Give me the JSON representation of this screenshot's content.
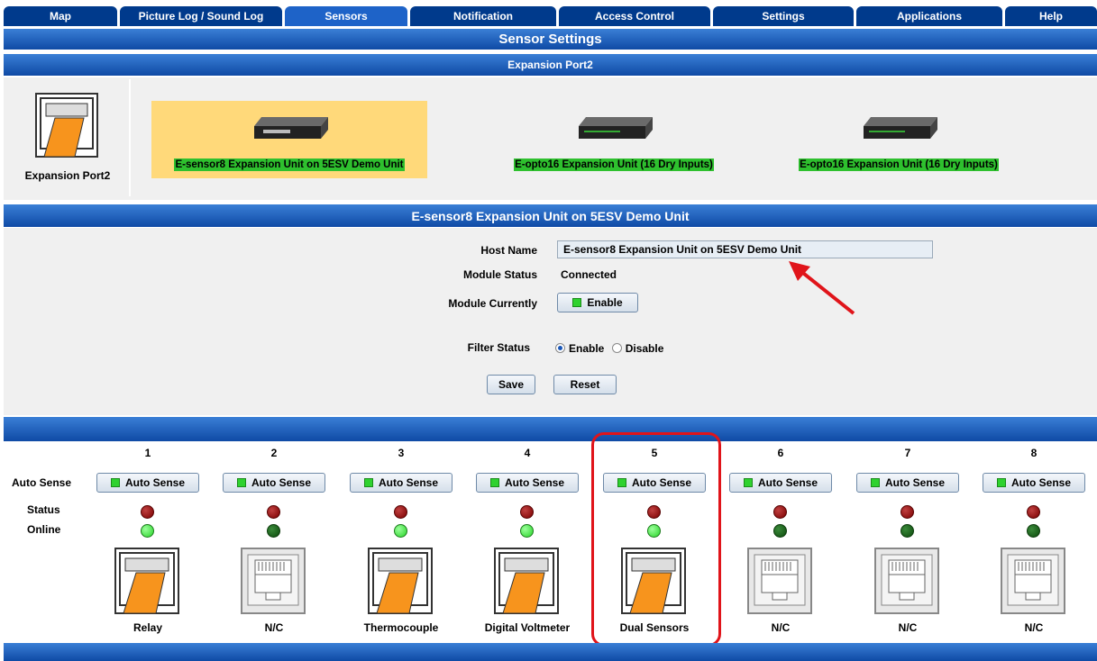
{
  "tabs": [
    {
      "label": "Map"
    },
    {
      "label": "Picture Log / Sound Log"
    },
    {
      "label": "Sensors"
    },
    {
      "label": "Notification"
    },
    {
      "label": "Access Control"
    },
    {
      "label": "Settings"
    },
    {
      "label": "Applications"
    },
    {
      "label": "Help"
    }
  ],
  "active_tab": "Sensors",
  "section_title": "Sensor Settings",
  "expansion_title": "Expansion Port2",
  "port_label": "Expansion Port2",
  "units": [
    {
      "label": "E-sensor8 Expansion Unit on 5ESV Demo Unit",
      "selected": true
    },
    {
      "label": "E-opto16 Expansion Unit (16 Dry Inputs)",
      "selected": false
    },
    {
      "label": "E-opto16 Expansion Unit (16 Dry Inputs)",
      "selected": false
    }
  ],
  "unit_title": "E-sensor8 Expansion Unit on 5ESV Demo Unit",
  "form": {
    "host_name_label": "Host Name",
    "host_name_value": "E-sensor8 Expansion Unit on 5ESV Demo Unit",
    "module_status_label": "Module Status",
    "module_status_value": "Connected",
    "module_currently_label": "Module Currently",
    "module_currently_button": "Enable",
    "filter_status_label": "Filter Status",
    "filter_enable": "Enable",
    "filter_disable": "Disable",
    "filter_selected": "Enable",
    "save": "Save",
    "reset": "Reset"
  },
  "row_labels": {
    "auto_sense": "Auto Sense",
    "status": "Status",
    "online": "Online"
  },
  "channels": [
    {
      "num": "1",
      "button": "Auto Sense",
      "online": true,
      "connected": true,
      "name": "Relay"
    },
    {
      "num": "2",
      "button": "Auto Sense",
      "online": false,
      "connected": false,
      "name": "N/C"
    },
    {
      "num": "3",
      "button": "Auto Sense",
      "online": true,
      "connected": true,
      "name": "Thermocouple"
    },
    {
      "num": "4",
      "button": "Auto Sense",
      "online": true,
      "connected": true,
      "name": "Digital Voltmeter"
    },
    {
      "num": "5",
      "button": "Auto Sense",
      "online": true,
      "connected": true,
      "name": "Dual Sensors"
    },
    {
      "num": "6",
      "button": "Auto Sense",
      "online": false,
      "connected": false,
      "name": "N/C"
    },
    {
      "num": "7",
      "button": "Auto Sense",
      "online": false,
      "connected": false,
      "name": "N/C"
    },
    {
      "num": "8",
      "button": "Auto Sense",
      "online": false,
      "connected": false,
      "name": "N/C"
    }
  ],
  "colors": {
    "header_blue": "#0f4aa5",
    "selected_unit": "#ffd97a",
    "unit_label_green": "#2ec02e",
    "annotation_red": "#e0141a"
  }
}
